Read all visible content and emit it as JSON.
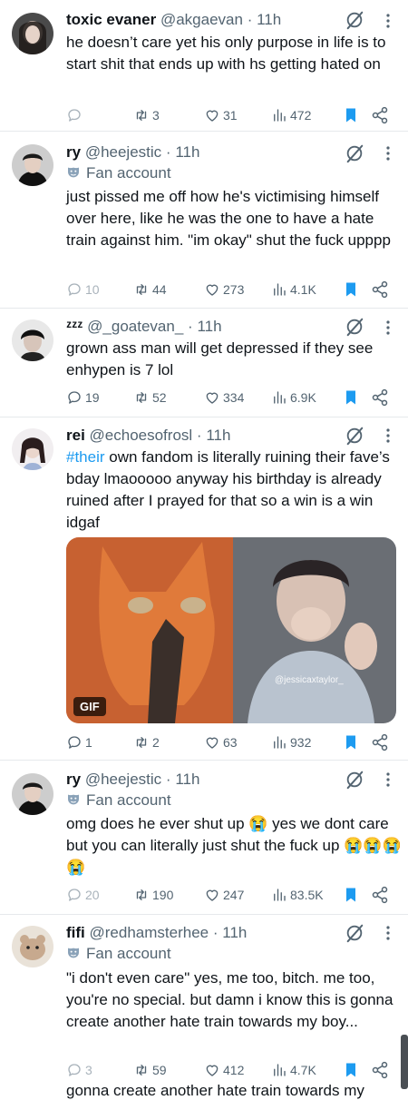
{
  "tweets": [
    {
      "name": "toxic evaner",
      "handle": "@akgaevan",
      "time": "11h",
      "text": "he doesn’t care yet his only purpose in life is to start shit that ends up with hs getting hated on",
      "replies": "",
      "retweets": "3",
      "likes": "31",
      "views": "472"
    },
    {
      "name": "ry",
      "handle": "@heejestic",
      "time": "11h",
      "label": "Fan account",
      "text": "just pissed me off how he's victimising himself over here, like he was the one to have a hate train against him. \"im okay\" shut the fuck upppp",
      "replies": "10",
      "retweets": "44",
      "likes": "273",
      "views": "4.1K"
    },
    {
      "name": "ᶻᶻᶻ",
      "handle": "@_goatevan_",
      "time": "11h",
      "text": "grown ass man will get depressed if they see enhypen is 7 lol",
      "replies": "19",
      "retweets": "52",
      "likes": "334",
      "views": "6.9K"
    },
    {
      "name": "rei",
      "handle": "@echoesofrosl",
      "time": "11h",
      "hashtag": "#their",
      "text": " own fandom is literally ruining their fave’s bday lmaooooo anyway his birthday is already ruined after I prayed for that so a win is a win idgaf",
      "media_badge": "GIF",
      "media_watermark": "@jessicaxtaylor_",
      "replies": "1",
      "retweets": "2",
      "likes": "63",
      "views": "932"
    },
    {
      "name": "ry",
      "handle": "@heejestic",
      "time": "11h",
      "label": "Fan account",
      "text": "omg does he ever shut up 😭 yes we dont care but you can literally just shut the fuck up 😭😭😭😭",
      "replies": "20",
      "retweets": "190",
      "likes": "247",
      "views": "83.5K"
    },
    {
      "name": "fifi",
      "handle": "@redhamsterhee",
      "time": "11h",
      "label": "Fan account",
      "text": "\"i don't even care\" yes, me too, bitch. me too, you're no special. but damn i know this is gonna create another hate train towards my boy...",
      "replies": "3",
      "retweets": "59",
      "likes": "412",
      "views": "4.7K"
    }
  ],
  "cut_off_text": "gonna create another hate train towards my",
  "colors": {
    "accent": "#1d9bf0",
    "muted": "#536471",
    "bookmark": "#1d9bf0",
    "divider": "#e6e9ec"
  },
  "icons": {
    "reply": "speech-bubble-icon",
    "retweet": "retweet-icon",
    "like": "heart-icon",
    "views": "bar-chart-icon",
    "bookmark": "bookmark-icon",
    "share": "share-icon",
    "grok": "grok-slash-circle-icon",
    "more": "vertical-dots-icon",
    "fan": "theater-mask-icon"
  }
}
